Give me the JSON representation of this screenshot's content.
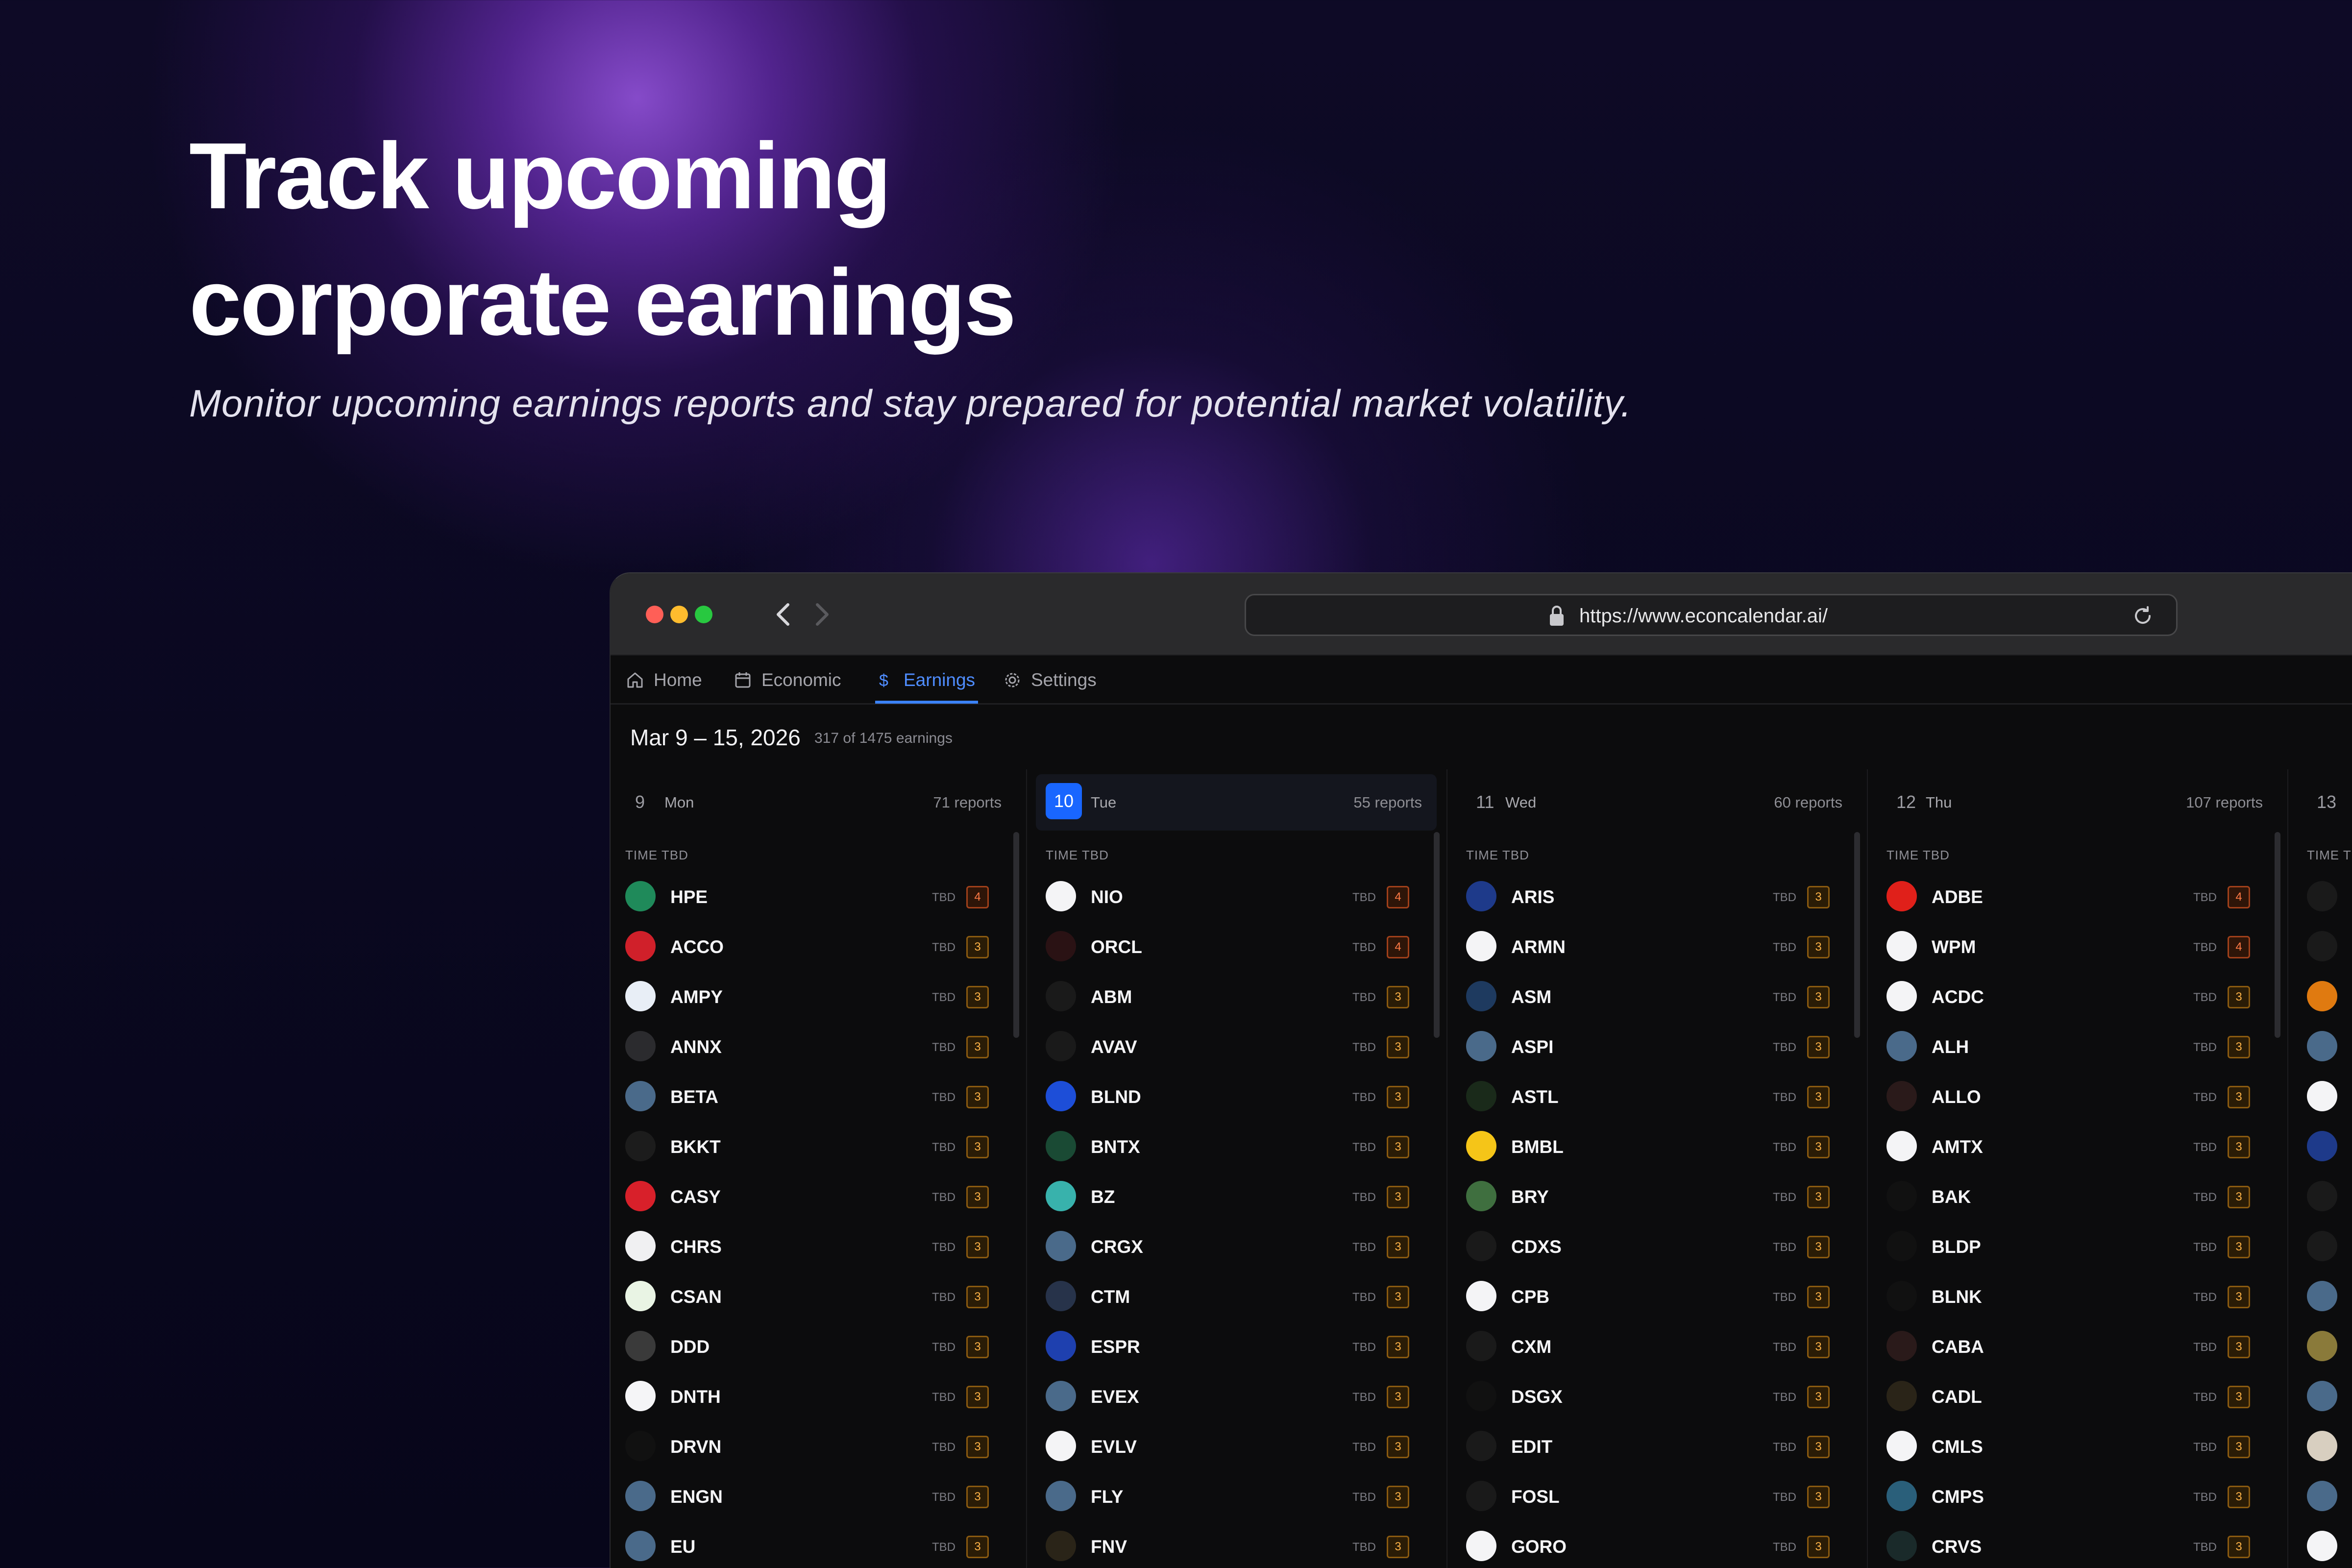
{
  "hero": {
    "title": "Track upcoming\ncorporate earnings",
    "subtitle": "Monitor upcoming earnings reports and stay prepared for potential market volatility."
  },
  "browser": {
    "url": "https://www.econcalendar.ai/"
  },
  "tabs": [
    {
      "label": "Home",
      "icon": "home-icon"
    },
    {
      "label": "Economic",
      "icon": "calendar-icon"
    },
    {
      "label": "Earnings",
      "icon": "dollar-icon",
      "active": true
    },
    {
      "label": "Settings",
      "icon": "gear-icon"
    }
  ],
  "range": {
    "title": "Mar 9 – 15, 2026",
    "count": "317 of 1475 earnings"
  },
  "time_label": "TIME TBD",
  "tbd_label": "TBD",
  "days": [
    {
      "num": "9",
      "name": "Mon",
      "reports": "71 reports",
      "active": false,
      "rows": [
        {
          "t": "HPE",
          "i": "4",
          "c": "#1f8a5a"
        },
        {
          "t": "ACCO",
          "i": "3",
          "c": "#d0202a"
        },
        {
          "t": "AMPY",
          "i": "3",
          "c": "#e8eef6"
        },
        {
          "t": "ANNX",
          "i": "3",
          "c": "#2b2b2e"
        },
        {
          "t": "BETA",
          "i": "3",
          "c": "#4a6a8a"
        },
        {
          "t": "BKKT",
          "i": "3",
          "c": "#1c1c1c"
        },
        {
          "t": "CASY",
          "i": "3",
          "c": "#d8202a"
        },
        {
          "t": "CHRS",
          "i": "3",
          "c": "#f0f0f2"
        },
        {
          "t": "CSAN",
          "i": "3",
          "c": "#e9f4e4"
        },
        {
          "t": "DDD",
          "i": "3",
          "c": "#3a3a3a"
        },
        {
          "t": "DNTH",
          "i": "3",
          "c": "#f5f5f7"
        },
        {
          "t": "DRVN",
          "i": "3",
          "c": "#111111"
        },
        {
          "t": "ENGN",
          "i": "3",
          "c": "#4a6a8a"
        },
        {
          "t": "EU",
          "i": "3",
          "c": "#4a6a8a"
        }
      ]
    },
    {
      "num": "10",
      "name": "Tue",
      "reports": "55 reports",
      "active": true,
      "rows": [
        {
          "t": "NIO",
          "i": "4",
          "c": "#f4f4f6"
        },
        {
          "t": "ORCL",
          "i": "4",
          "c": "#2a1214"
        },
        {
          "t": "ABM",
          "i": "3",
          "c": "#1a1a1a"
        },
        {
          "t": "AVAV",
          "i": "3",
          "c": "#1a1a1a"
        },
        {
          "t": "BLND",
          "i": "3",
          "c": "#1d4ed8"
        },
        {
          "t": "BNTX",
          "i": "3",
          "c": "#1a4a34"
        },
        {
          "t": "BZ",
          "i": "3",
          "c": "#38b2ac"
        },
        {
          "t": "CRGX",
          "i": "3",
          "c": "#4a6a8a"
        },
        {
          "t": "CTM",
          "i": "3",
          "c": "#27334a"
        },
        {
          "t": "ESPR",
          "i": "3",
          "c": "#1e40af"
        },
        {
          "t": "EVEX",
          "i": "3",
          "c": "#4a6a8a"
        },
        {
          "t": "EVLV",
          "i": "3",
          "c": "#f4f4f6"
        },
        {
          "t": "FLY",
          "i": "3",
          "c": "#4a6a8a"
        },
        {
          "t": "FNV",
          "i": "3",
          "c": "#2a2418"
        }
      ]
    },
    {
      "num": "11",
      "name": "Wed",
      "reports": "60 reports",
      "active": false,
      "rows": [
        {
          "t": "ARIS",
          "i": "3",
          "c": "#1e3a8a"
        },
        {
          "t": "ARMN",
          "i": "3",
          "c": "#f4f4f6"
        },
        {
          "t": "ASM",
          "i": "3",
          "c": "#1e3a5f"
        },
        {
          "t": "ASPI",
          "i": "3",
          "c": "#4a6a8a"
        },
        {
          "t": "ASTL",
          "i": "3",
          "c": "#1a2a1a"
        },
        {
          "t": "BMBL",
          "i": "3",
          "c": "#f5c518"
        },
        {
          "t": "BRY",
          "i": "3",
          "c": "#3f6f3f"
        },
        {
          "t": "CDXS",
          "i": "3",
          "c": "#1a1a1a"
        },
        {
          "t": "CPB",
          "i": "3",
          "c": "#f4f4f6"
        },
        {
          "t": "CXM",
          "i": "3",
          "c": "#1a1a1a"
        },
        {
          "t": "DSGX",
          "i": "3",
          "c": "#111111"
        },
        {
          "t": "EDIT",
          "i": "3",
          "c": "#1a1a1a"
        },
        {
          "t": "FOSL",
          "i": "3",
          "c": "#1a1a1a"
        },
        {
          "t": "GORO",
          "i": "3",
          "c": "#f4f4f6"
        }
      ]
    },
    {
      "num": "12",
      "name": "Thu",
      "reports": "107 reports",
      "active": false,
      "rows": [
        {
          "t": "ADBE",
          "i": "4",
          "c": "#e0201a"
        },
        {
          "t": "WPM",
          "i": "4",
          "c": "#f4f4f6"
        },
        {
          "t": "ACDC",
          "i": "3",
          "c": "#f4f4f6"
        },
        {
          "t": "ALH",
          "i": "3",
          "c": "#4a6a8a"
        },
        {
          "t": "ALLO",
          "i": "3",
          "c": "#2a1a1a"
        },
        {
          "t": "AMTX",
          "i": "3",
          "c": "#f4f4f6"
        },
        {
          "t": "BAK",
          "i": "3",
          "c": "#111111"
        },
        {
          "t": "BLDP",
          "i": "3",
          "c": "#111111"
        },
        {
          "t": "BLNK",
          "i": "3",
          "c": "#111111"
        },
        {
          "t": "CABA",
          "i": "3",
          "c": "#2a1a1a"
        },
        {
          "t": "CADL",
          "i": "3",
          "c": "#2a2418"
        },
        {
          "t": "CMLS",
          "i": "3",
          "c": "#f4f4f6"
        },
        {
          "t": "CMPS",
          "i": "3",
          "c": "#2a5f7a"
        },
        {
          "t": "CRVS",
          "i": "3",
          "c": "#1a2a2a"
        }
      ]
    },
    {
      "num": "13",
      "name": "",
      "reports": "",
      "active": false,
      "rows": [
        {
          "t": "",
          "i": "",
          "c": "#1a1a1a"
        },
        {
          "t": "",
          "i": "",
          "c": "#1a1a1a"
        },
        {
          "t": "",
          "i": "",
          "c": "#e07a10"
        },
        {
          "t": "",
          "i": "",
          "c": "#4a6a8a"
        },
        {
          "t": "",
          "i": "",
          "c": "#f4f4f6"
        },
        {
          "t": "",
          "i": "",
          "c": "#1e3a8a"
        },
        {
          "t": "",
          "i": "",
          "c": "#1a1a1a"
        },
        {
          "t": "",
          "i": "",
          "c": "#1a1a1a"
        },
        {
          "t": "",
          "i": "",
          "c": "#4a6a8a"
        },
        {
          "t": "",
          "i": "",
          "c": "#8a7a3a"
        },
        {
          "t": "",
          "i": "",
          "c": "#4a6a8a"
        },
        {
          "t": "",
          "i": "",
          "c": "#d8cfc0"
        },
        {
          "t": "",
          "i": "",
          "c": "#4a6a8a"
        },
        {
          "t": "",
          "i": "",
          "c": "#f4f4f6"
        }
      ]
    }
  ],
  "colors": {
    "accent": "#3b82f6",
    "today_badge": "#1966ff",
    "close_light": "#ff5f57",
    "minimize_light": "#febc2e",
    "zoom_light": "#28c840"
  }
}
